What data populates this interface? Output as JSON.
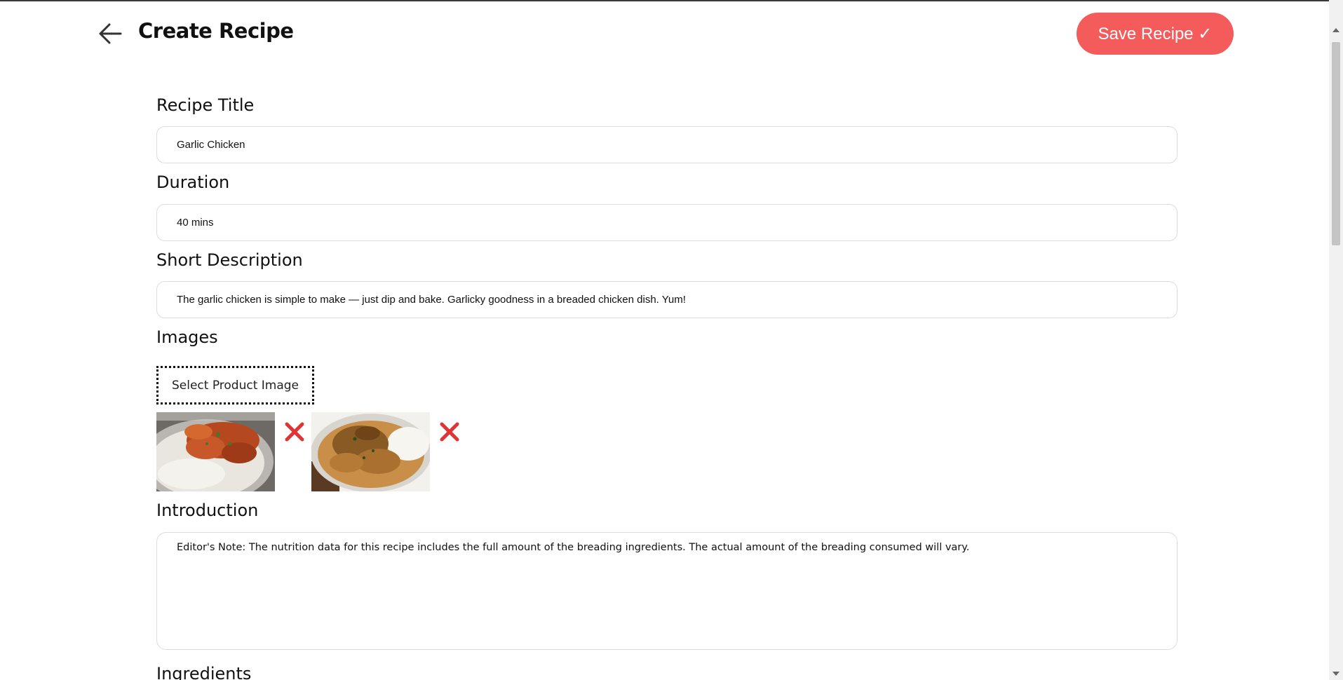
{
  "header": {
    "title": "Create Recipe",
    "save_label": "Save Recipe ✓",
    "accent_color": "#f45b5b"
  },
  "form": {
    "recipe_title": {
      "label": "Recipe Title",
      "value": "Garlic Chicken"
    },
    "duration": {
      "label": "Duration",
      "value": "40 mins"
    },
    "short_description": {
      "label": "Short Description",
      "value": "The garlic chicken is simple to make — just dip and bake. Garlicky goodness in a breaded chicken dish. Yum!"
    },
    "images": {
      "label": "Images",
      "select_label": "Select Product Image",
      "items": [
        {
          "name": "chicken-rice-image-1",
          "remove_icon": "close-icon"
        },
        {
          "name": "chicken-rice-image-2",
          "remove_icon": "close-icon"
        }
      ]
    },
    "introduction": {
      "label": "Introduction",
      "value": "Editor's Note: The nutrition data for this recipe includes the full amount of the breading ingredients. The actual amount of the breading consumed will vary."
    },
    "ingredients": {
      "label": "Ingredients"
    }
  },
  "icons": {
    "back": "arrow-left-icon",
    "remove": "red-x-icon"
  }
}
